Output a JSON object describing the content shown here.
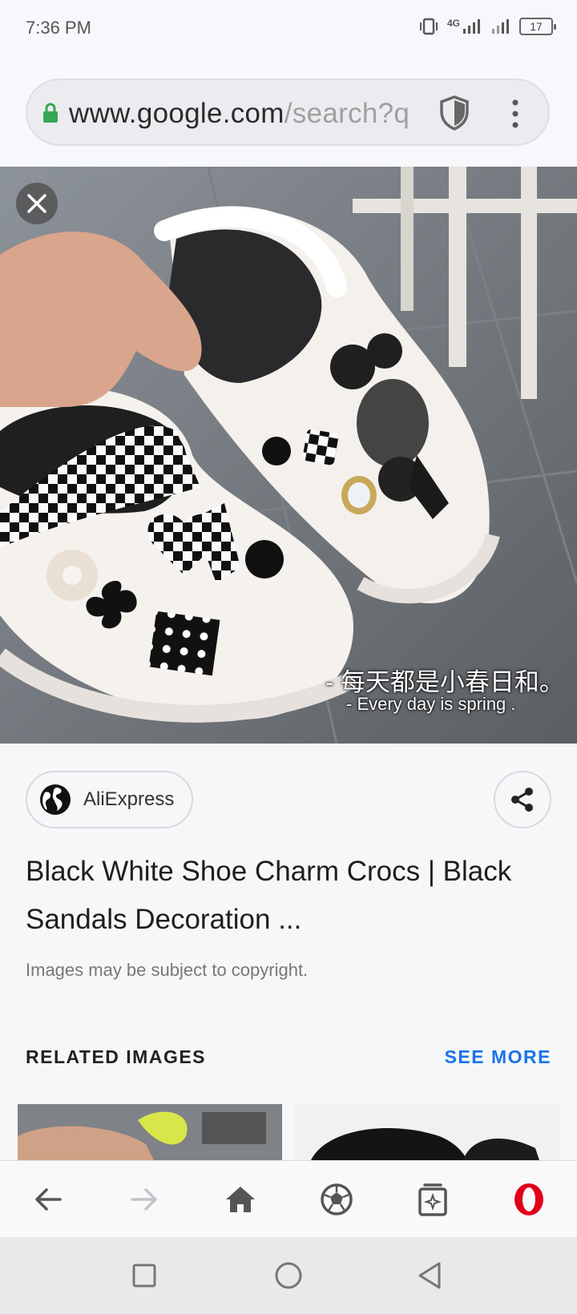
{
  "status_bar": {
    "time": "7:36 PM",
    "network": "4G",
    "battery": "17"
  },
  "address_bar": {
    "host": "www.google.com",
    "path": "/search?q"
  },
  "photo": {
    "caption_cn": "- 每天都是小春日和。",
    "caption_en": "- Every day is spring ."
  },
  "result": {
    "source": "AliExpress",
    "title": "Black White Shoe Charm Crocs | Black Sandals Decoration ...",
    "copyright": "Images may be subject to copyright.",
    "related_label": "RELATED IMAGES",
    "see_more": "SEE MORE"
  },
  "icons": {
    "lock": "lock-icon",
    "shield": "shield-icon",
    "menu": "more-vert-icon",
    "close": "close-icon",
    "globe": "globe-icon",
    "share": "share-icon",
    "back": "arrow-left-icon",
    "forward": "arrow-right-icon",
    "home": "home-icon",
    "discover": "soccer-ball-icon",
    "tabs": "tabs-icon",
    "opera": "opera-icon"
  },
  "colors": {
    "accent": "#1a73e8",
    "lock_green": "#34a853",
    "opera_red": "#e0001b"
  }
}
